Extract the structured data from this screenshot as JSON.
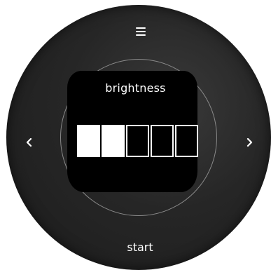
{
  "screen": {
    "title": "brightness",
    "level": {
      "filled": 2,
      "total": 5
    }
  },
  "controls": {
    "menu_icon": "hamburger-menu-icon",
    "left_icon": "chevron-left-icon",
    "right_icon": "chevron-right-icon",
    "start_label": "start"
  },
  "colors": {
    "body": "#262626",
    "screen": "#000000",
    "foreground": "#ffffff",
    "ring": "#8a8a8a"
  }
}
